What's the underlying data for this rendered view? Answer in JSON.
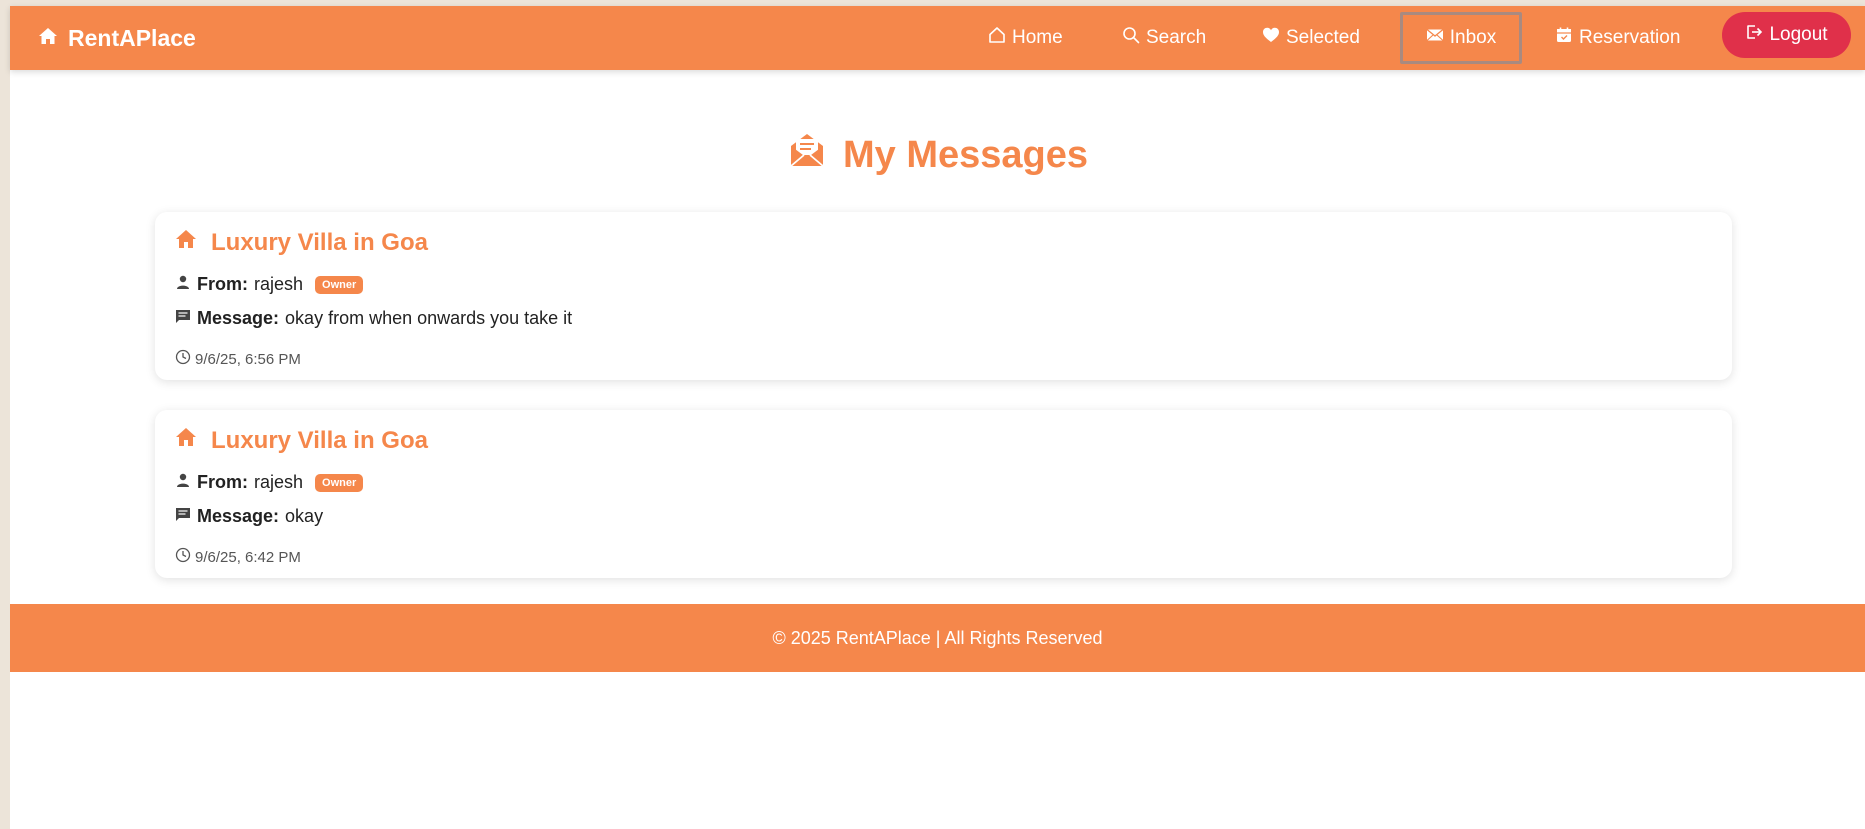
{
  "brand": {
    "name": "RentAPlace",
    "icon": "house-icon"
  },
  "nav": {
    "home": "Home",
    "search": "Search",
    "selected": "Selected",
    "inbox": "Inbox",
    "reservation": "Reservation",
    "logout": "Logout"
  },
  "page_title": "My Messages",
  "messages": [
    {
      "property": "Luxury Villa in Goa",
      "from_label": "From:",
      "from": "rajesh",
      "role": "Owner",
      "message_label": "Message:",
      "message": "okay from when onwards you take it",
      "time": "9/6/25, 6:56 PM"
    },
    {
      "property": "Luxury Villa in Goa",
      "from_label": "From:",
      "from": "rajesh",
      "role": "Owner",
      "message_label": "Message:",
      "message": "okay",
      "time": "9/6/25, 6:42 PM"
    }
  ],
  "footer": "© 2025 RentAPlace | All Rights Reserved",
  "colors": {
    "primary": "#f5874b",
    "logout": "#e0304a",
    "background": "#ece4d9"
  }
}
